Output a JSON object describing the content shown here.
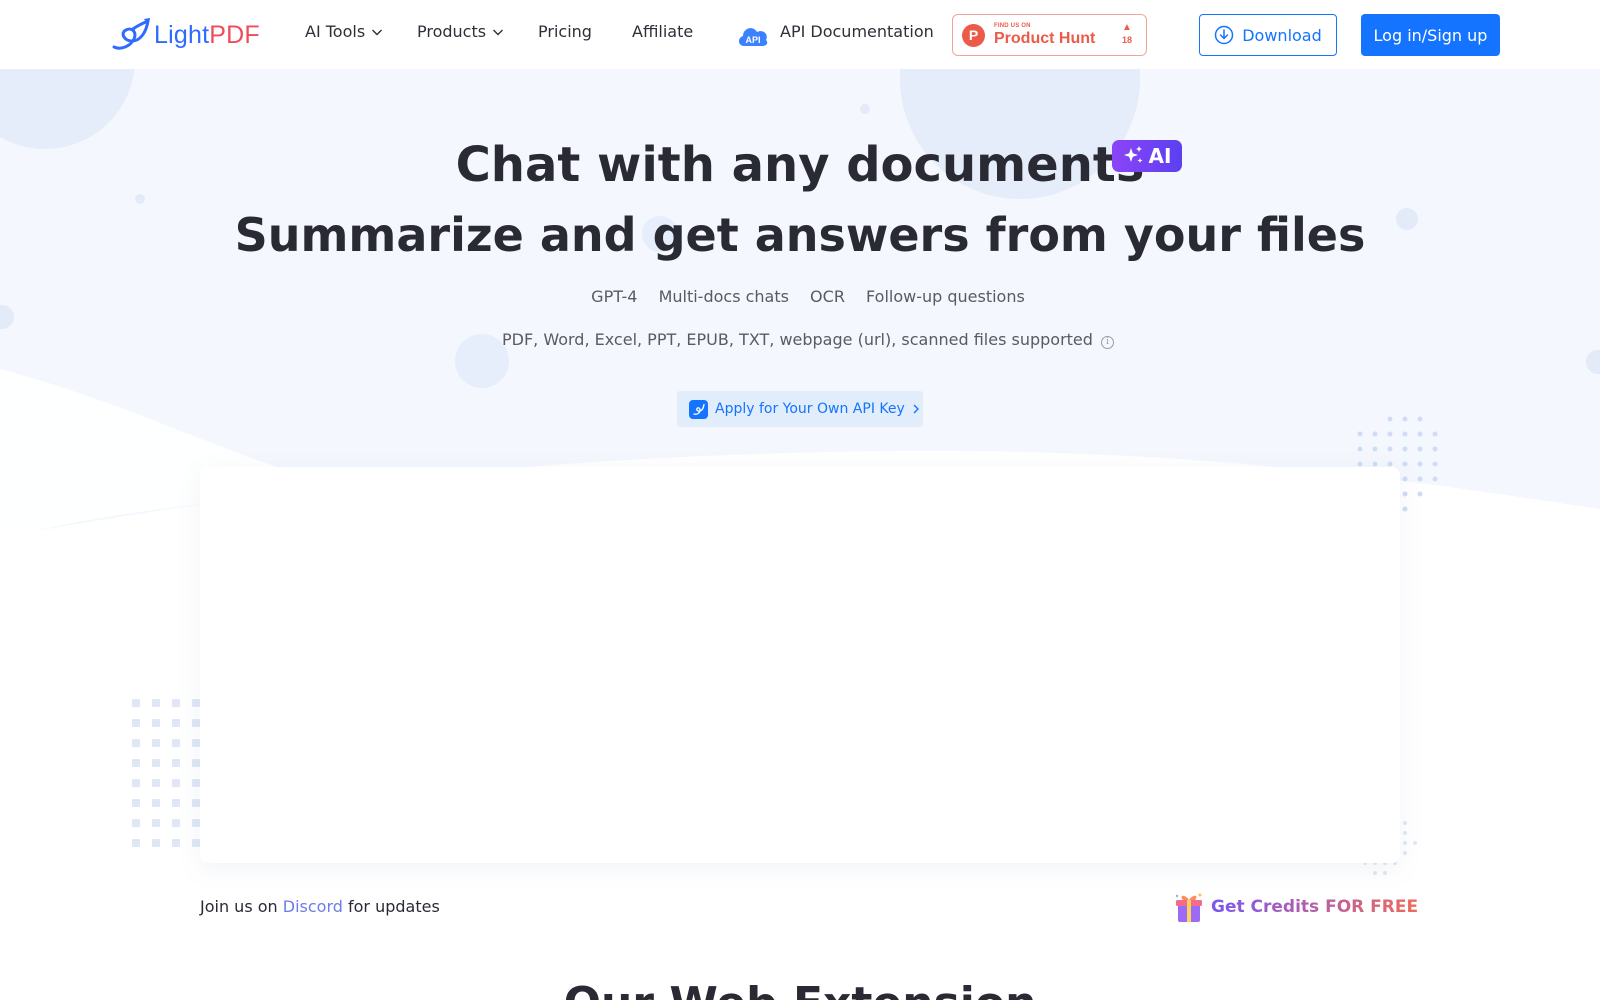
{
  "header": {
    "logo": {
      "light": "Light",
      "pdf": "PDF"
    },
    "nav": [
      {
        "label": "AI Tools",
        "has_dropdown": true
      },
      {
        "label": "Products",
        "has_dropdown": true
      },
      {
        "label": "Pricing",
        "has_dropdown": false
      },
      {
        "label": "Affiliate",
        "has_dropdown": false
      }
    ],
    "api_icon_text": "API",
    "api_docs_label": "API Documentation",
    "product_hunt": {
      "circle_letter": "P",
      "small": "FIND US ON",
      "big": "Product Hunt",
      "votes": "18"
    },
    "download_label": "Download",
    "login_label": "Log in/Sign up"
  },
  "hero": {
    "title_line1": "Chat with any documents",
    "ai_badge": "AI",
    "title_line2": "Summarize and get answers from your files",
    "features": " GPT-4  Multi-docs chats  OCR  Follow-up questions",
    "formats": " PDF, Word, Excel, PPT, EPUB, TXT, webpage (url), scanned files supported",
    "info_glyph": "i",
    "api_key_label": "Apply for Your Own API Key"
  },
  "footer_row": {
    "discord_prefix": "Join us on ",
    "discord_link": "Discord",
    "discord_suffix": " for updates",
    "credits_label": "Get Credits FOR FREE"
  },
  "next_section_title": "Our Web Extension",
  "colors": {
    "brand_blue": "#1474ff",
    "brand_red": "#f04b5a",
    "ai_purple": "#8b45f7",
    "product_hunt": "#ec5a4a",
    "discord": "#6e7ce8"
  }
}
